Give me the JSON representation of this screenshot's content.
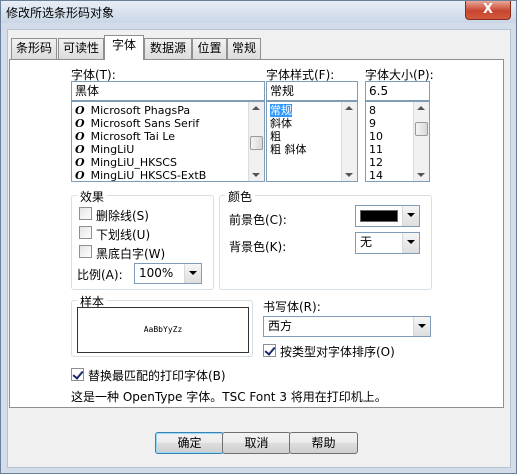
{
  "window": {
    "title": "修改所选条形码对象",
    "close_label": "X"
  },
  "tabs": [
    {
      "label": "条形码"
    },
    {
      "label": "可读性"
    },
    {
      "label": "字体",
      "active": true
    },
    {
      "label": "数据源"
    },
    {
      "label": "位置"
    },
    {
      "label": "常规"
    }
  ],
  "font": {
    "label": "字体(T):",
    "value": "黑体",
    "items": [
      "Microsoft PhagsPa",
      "Microsoft Sans Serif",
      "Microsoft Tai Le",
      "MingLiU",
      "MingLiU_HKSCS",
      "MingLiU_HKSCS-ExtB"
    ],
    "item_icon": "opentype-icon",
    "item_icon_glyph": "O"
  },
  "style": {
    "label": "字体样式(F):",
    "value": "常规",
    "items": [
      "常规",
      "斜体",
      "粗",
      "粗 斜体"
    ],
    "selected": "常规"
  },
  "size": {
    "label": "字体大小(P):",
    "value": "6.5",
    "items": [
      "8",
      "9",
      "10",
      "11",
      "12",
      "14"
    ]
  },
  "effects": {
    "title": "效果",
    "strikethrough": {
      "label": "删除线(S)",
      "checked": false
    },
    "underline": {
      "label": "下划线(U)",
      "checked": false
    },
    "reverse": {
      "label": "黑底白字(W)",
      "checked": false
    },
    "scale_label": "比例(A):",
    "scale_value": "100%"
  },
  "color": {
    "title": "颜色",
    "foreground_label": "前景色(C):",
    "foreground_value": "#000000",
    "background_label": "背景色(K):",
    "background_value": "无"
  },
  "sample": {
    "title": "样本",
    "text": "AaBbYyZz"
  },
  "script": {
    "label": "书写体(R):",
    "value": "西方",
    "type_sort_label": "按类型对字体排序(O)",
    "type_sort_checked": true
  },
  "substitute": {
    "label": "替换最匹配的打印字体(B)",
    "checked": true
  },
  "info_text": "这是一种 OpenType 字体。TSC Font 3 将用在打印机上。",
  "buttons": {
    "ok": "确定",
    "cancel": "取消",
    "help": "帮助"
  }
}
